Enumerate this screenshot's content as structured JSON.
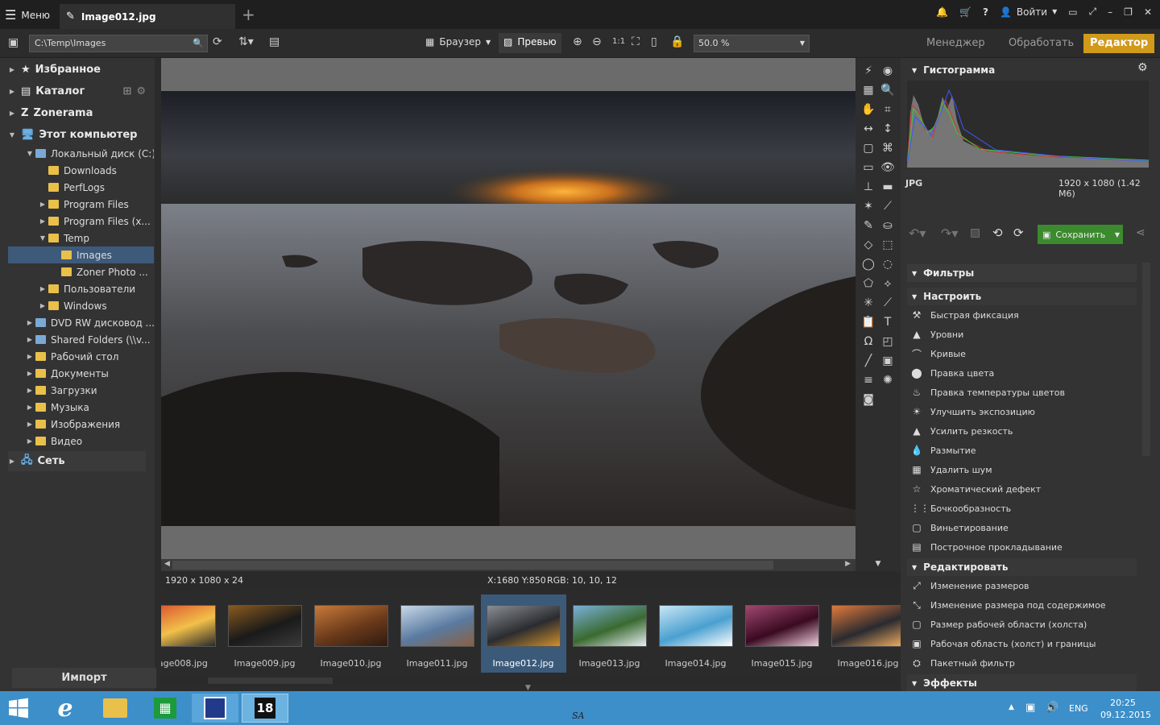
{
  "titlebar": {
    "menu_label": "Меню",
    "tab_title": "Image012.jpg",
    "login_label": "Войти"
  },
  "toolbar": {
    "path": "C:\\Temp\\Images",
    "browser_label": "Браузер",
    "preview_label": "Превью",
    "zoom": "50.0 %",
    "modes": [
      "Менеджер",
      "Обработать",
      "Редактор"
    ],
    "active_mode": "Редактор"
  },
  "sidebar": {
    "top_items": [
      "Избранное",
      "Каталог",
      "Zonerama",
      "Этот компьютер"
    ],
    "tree": [
      {
        "label": "Локальный диск (C:)",
        "level": 1
      },
      {
        "label": "Downloads",
        "level": 2
      },
      {
        "label": "PerfLogs",
        "level": 2
      },
      {
        "label": "Program Files",
        "level": 2
      },
      {
        "label": "Program Files (x...",
        "level": 2
      },
      {
        "label": "Temp",
        "level": 2
      },
      {
        "label": "Images",
        "level": 3,
        "selected": true
      },
      {
        "label": "Zoner Photo ...",
        "level": 3
      },
      {
        "label": "Пользователи",
        "level": 2
      },
      {
        "label": "Windows",
        "level": 2
      },
      {
        "label": "DVD RW дисковод ...",
        "level": 1
      },
      {
        "label": "Shared Folders (\\\\v...",
        "level": 1
      },
      {
        "label": "Рабочий стол",
        "level": 1
      },
      {
        "label": "Документы",
        "level": 1
      },
      {
        "label": "Загрузки",
        "level": 1
      },
      {
        "label": "Музыка",
        "level": 1
      },
      {
        "label": "Изображения",
        "level": 1
      },
      {
        "label": "Видео",
        "level": 1
      }
    ],
    "network_label": "Сеть",
    "import_label": "Импорт"
  },
  "info": {
    "dims": "1920 x 1080 x 24",
    "coords": "X:1680 Y:850",
    "rgb": "RGB: 10, 10, 12"
  },
  "filmstrip": {
    "items": [
      "mage008.jpg",
      "Image009.jpg",
      "Image010.jpg",
      "Image011.jpg",
      "Image012.jpg",
      "Image013.jpg",
      "Image014.jpg",
      "Image015.jpg",
      "Image016.jpg"
    ],
    "selected": "Image012.jpg"
  },
  "rpanel": {
    "histogram_title": "Гистограмма",
    "format": "JPG",
    "size_info": "1920 x 1080 (1.42 M6)",
    "save_label": "Сохранить",
    "filters_title": "Фильтры",
    "adjust_title": "Настроить",
    "adjust_items": [
      "Быстрая фиксация",
      "Уровни",
      "Кривые",
      "Правка цвета",
      "Правка температуры цветов",
      "Улучшить экспозицию",
      "Усилить резкость",
      "Размытие",
      "Удалить шум",
      "Хроматический дефект",
      "Бочкообразность",
      "Виньетирование",
      "Построчное прокладывание"
    ],
    "edit_title": "Редактировать",
    "edit_items": [
      "Изменение размеров",
      "Изменение размера под содержимое",
      "Размер рабочей области (холста)",
      "Рабочая область (холст) и границы",
      "Пакетный фильтр"
    ],
    "effects_title": "Эффекты"
  },
  "taskbar": {
    "lang": "ENG",
    "time": "20:25",
    "date": "09.12.2015",
    "center_text": "SA"
  },
  "colors": {
    "accent": "#d19a1b",
    "selection": "#3d5a7a",
    "save_green": "#3c8a2e",
    "taskbar": "#3d8fc9"
  }
}
